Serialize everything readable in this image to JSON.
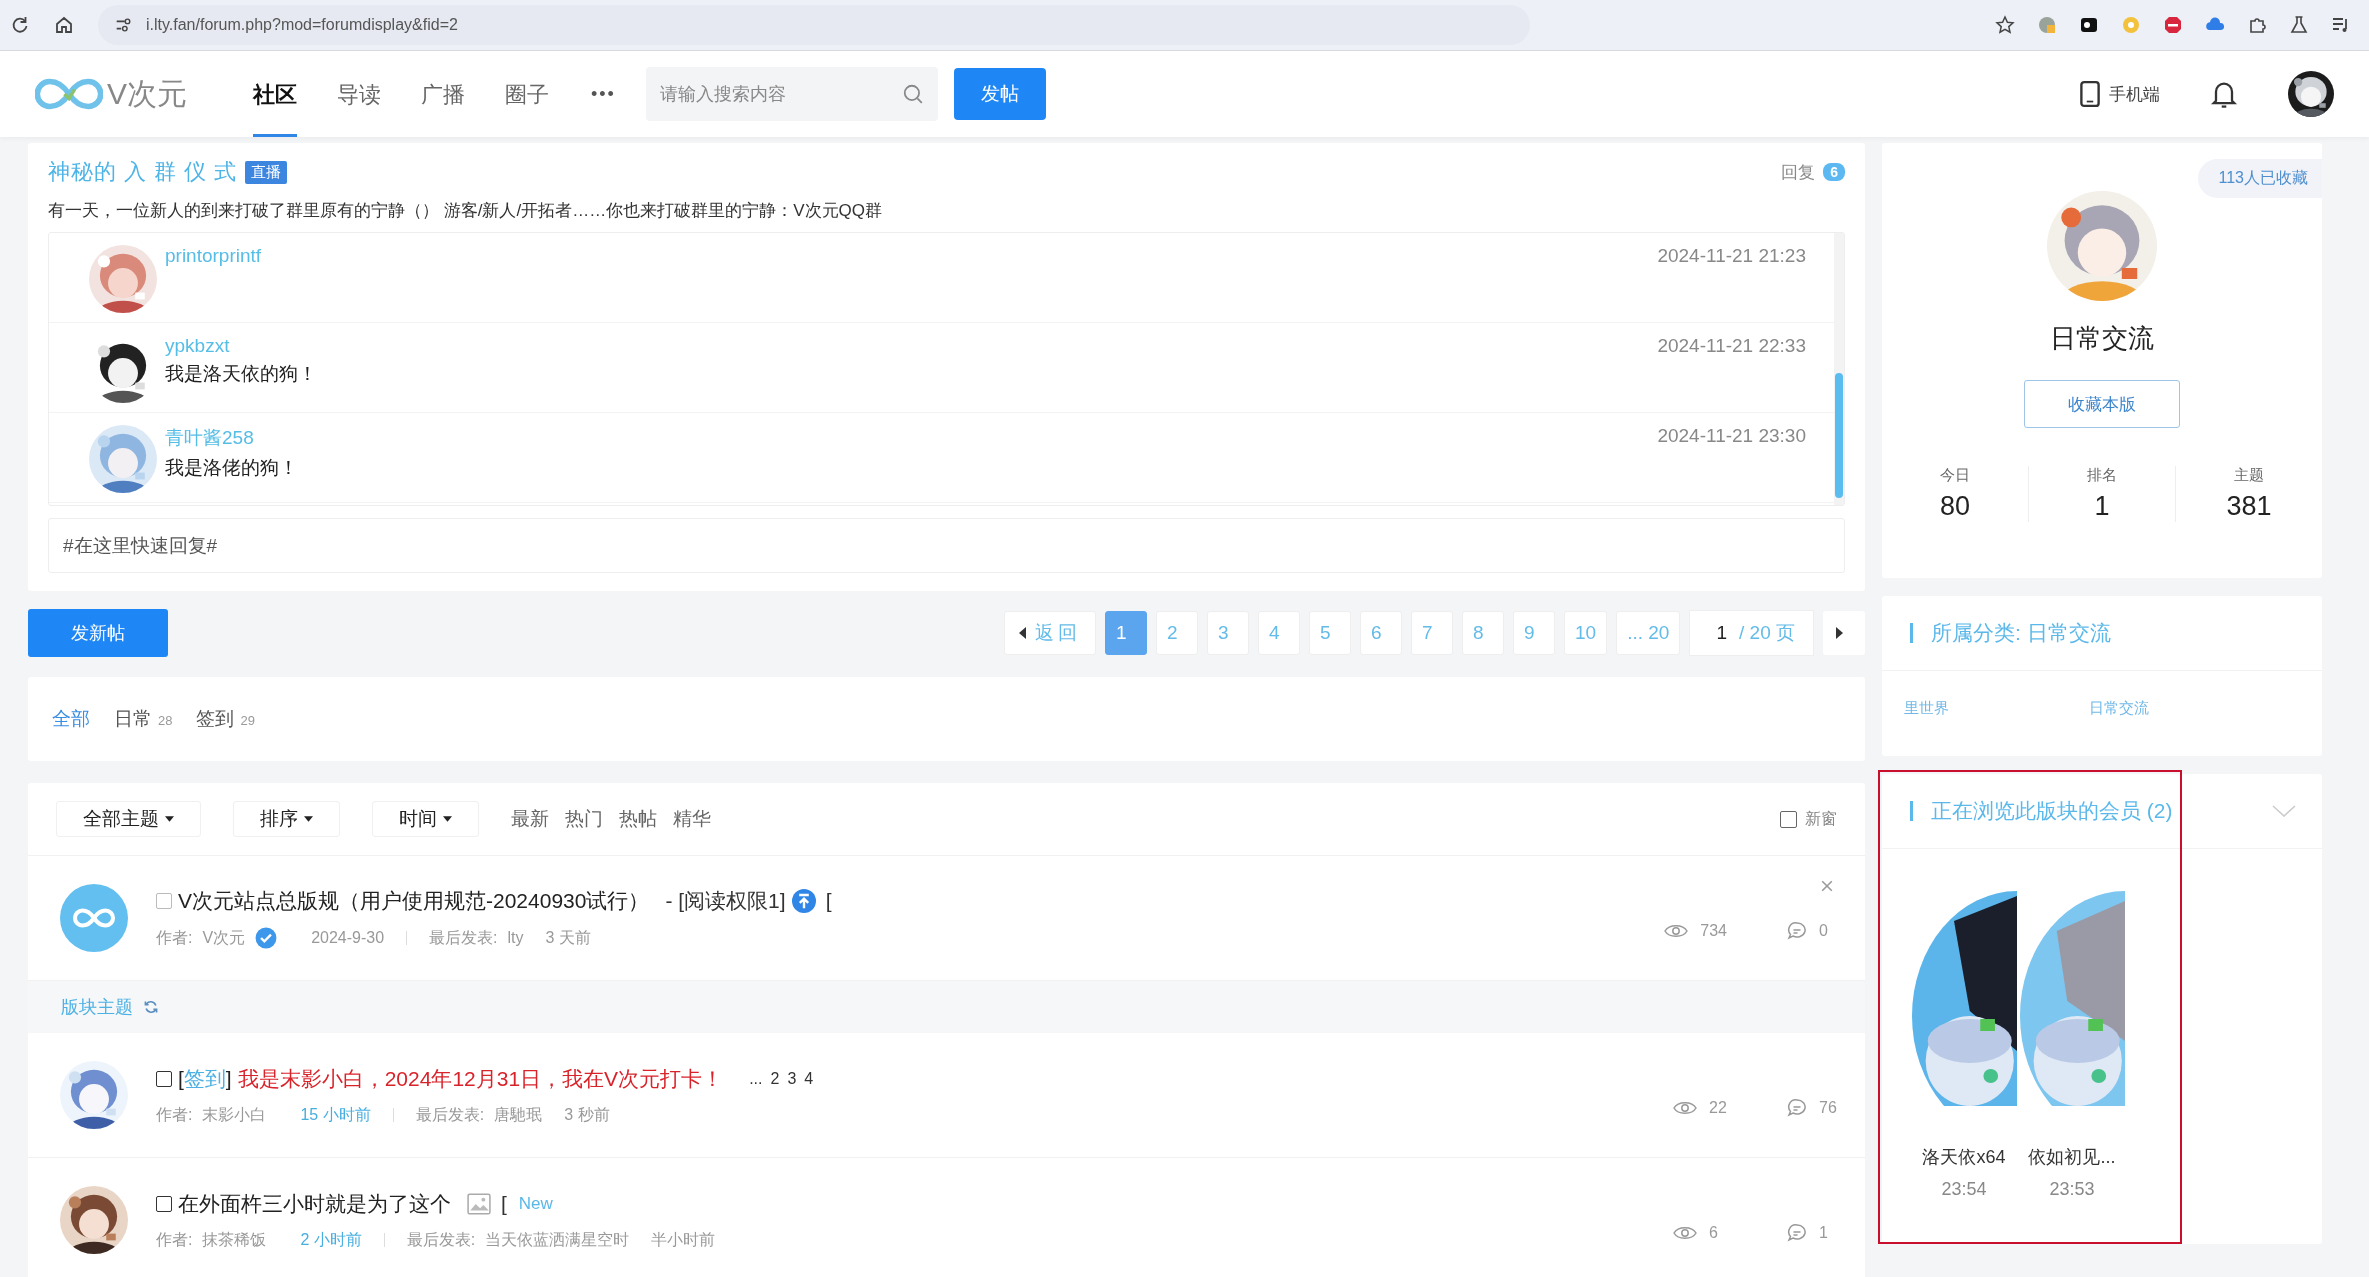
{
  "browser": {
    "url": "i.lty.fan/forum.php?mod=forumdisplay&fid=2"
  },
  "nav": {
    "logo_text": "V次元",
    "items": [
      {
        "label": "社区",
        "selected": true
      },
      {
        "label": "导读",
        "selected": false
      },
      {
        "label": "广播",
        "selected": false
      },
      {
        "label": "圈子",
        "selected": false
      }
    ],
    "more": "•••",
    "search": {
      "placeholder": "请输入搜索内容"
    },
    "post_button": "发帖",
    "mobile": "手机端"
  },
  "live": {
    "title": "神秘的 入 群 仪 式",
    "badge": "直播",
    "reply_label": "回复",
    "reply_count": "6",
    "description": "有一天，一位新人的到来打破了群里原有的宁静（） 游客/新人/开拓者……你也来打破群里的宁静：V次元QQ群",
    "messages": [
      {
        "user": "printorprintf",
        "time": "2024-11-21 21:23"
      },
      {
        "user": "ypkbzxt",
        "time": "2024-11-21 22:33",
        "text": "我是洛天依的狗！"
      },
      {
        "user": "青叶酱258",
        "time": "2024-11-21 23:30",
        "text": "我是洛佬的狗！"
      }
    ],
    "input": {
      "placeholder": "#在这里快速回复#"
    }
  },
  "new_post_button": "发新帖",
  "pagination": {
    "prev": "返回",
    "pages": [
      {
        "label": "1",
        "selected": true
      },
      {
        "label": "2",
        "selected": false
      },
      {
        "label": "3",
        "selected": false
      },
      {
        "label": "4",
        "selected": false
      },
      {
        "label": "5",
        "selected": false
      },
      {
        "label": "6",
        "selected": false
      },
      {
        "label": "7",
        "selected": false
      },
      {
        "label": "8",
        "selected": false
      },
      {
        "label": "9",
        "selected": false
      },
      {
        "label": "10",
        "selected": false
      },
      {
        "label": "... 20",
        "selected": false
      }
    ],
    "page_input": "1",
    "page_total": "/ 20 页"
  },
  "categories": [
    {
      "label": "全部",
      "selected": true
    },
    {
      "label": "日常",
      "count": "28",
      "selected": false
    },
    {
      "label": "签到",
      "count": "29",
      "selected": false
    }
  ],
  "filters": {
    "dropdowns": [
      "全部主题",
      "排序",
      "时间"
    ],
    "links": [
      "最新",
      "热门",
      "热帖",
      "精华"
    ],
    "new_window": {
      "label": "新窗",
      "checked": false
    }
  },
  "sticky_threads": [
    {
      "title": "V次元站点总版规（用户使用规范-20240930试行）",
      "suffix": "- [阅读权限1]",
      "trailer": "[",
      "author_label": "作者:",
      "author": "V次元",
      "verified": true,
      "date": "2024-9-30",
      "last_label": "最后发表:",
      "last_user": "lty",
      "last_time": "3 天前",
      "views": "734",
      "replies": "0"
    }
  ],
  "section": {
    "label": "版块主题"
  },
  "threads": [
    {
      "tag": {
        "open": "[",
        "label": "签到",
        "close": "]"
      },
      "title": "我是末影小白，2024年12月31日，我在V次元打卡！",
      "highlighted": true,
      "pages": [
        "...",
        "2",
        "3",
        "4"
      ],
      "author_label": "作者:",
      "author": "末影小白",
      "date": "15 小时前",
      "last_label": "最后发表:",
      "last_user": "唐馳珉",
      "last_time": "3 秒前",
      "views": "22",
      "replies": "76"
    },
    {
      "title": "在外面杵三小时就是为了这个",
      "highlighted": false,
      "has_image": true,
      "trailer": "[",
      "badge": "New",
      "author_label": "作者:",
      "author": "抹茶稀饭",
      "date": "2 小时前",
      "last_label": "最后发表:",
      "last_user": "当天依蓝洒满星空时",
      "last_time": "半小时前",
      "views": "6",
      "replies": "1"
    }
  ],
  "forum": {
    "favorites": "113人已收藏",
    "name": "日常交流",
    "favorite_button": "收藏本版",
    "stats": [
      {
        "label": "今日",
        "value": "80"
      },
      {
        "label": "排名",
        "value": "1"
      },
      {
        "label": "主题",
        "value": "381"
      }
    ]
  },
  "category": {
    "title": "所属分类: 日常交流",
    "links": [
      "里世界",
      "日常交流"
    ]
  },
  "online": {
    "title": "正在浏览此版块的会员 (2)",
    "members": [
      {
        "name": "洛天依x64",
        "time": "23:54"
      },
      {
        "name": "依如初见...",
        "time": "23:53"
      }
    ]
  }
}
